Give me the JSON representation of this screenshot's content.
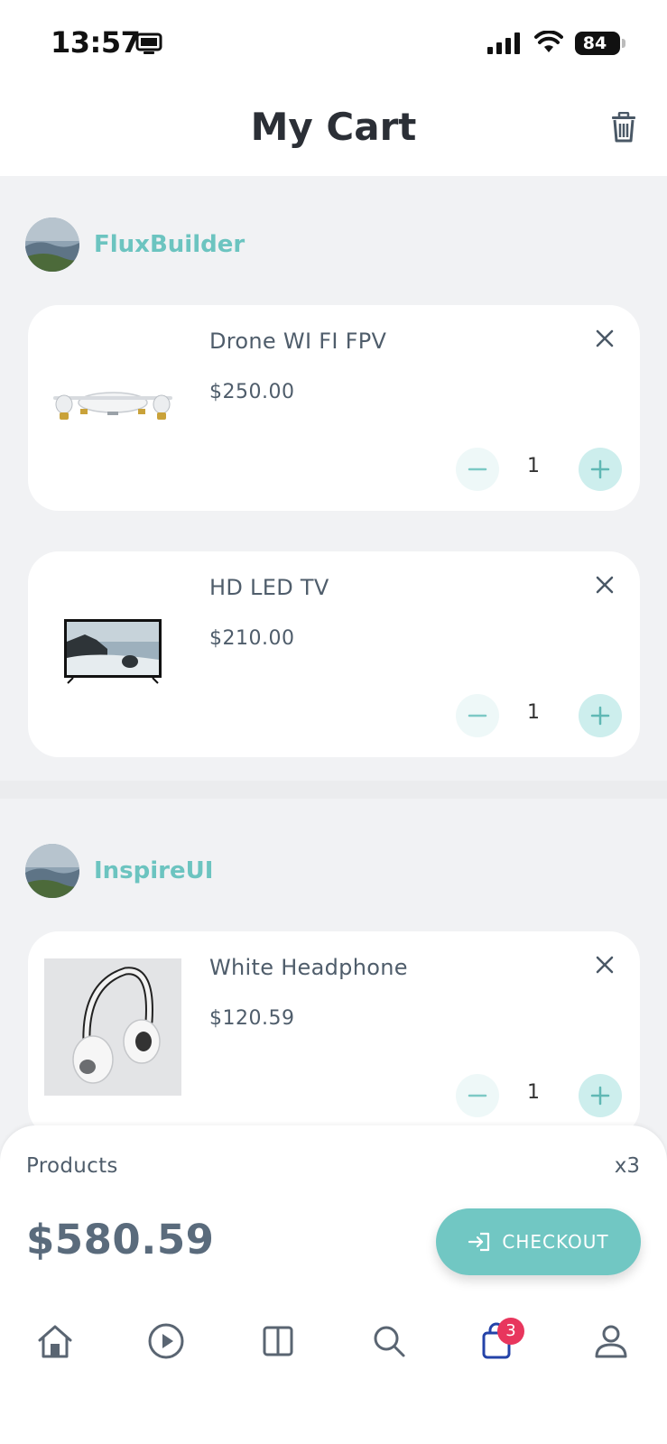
{
  "status_bar": {
    "time": "13:57",
    "battery": "84"
  },
  "header": {
    "title": "My Cart"
  },
  "stores": [
    {
      "name": "FluxBuilder",
      "items": [
        {
          "name": "Drone WI FI FPV",
          "price": "$250.00",
          "quantity": "1"
        },
        {
          "name": "HD LED TV",
          "price": "$210.00",
          "quantity": "1"
        }
      ]
    },
    {
      "name": "InspireUI",
      "items": [
        {
          "name": "White Headphone",
          "price": "$120.59",
          "quantity": "1"
        }
      ]
    }
  ],
  "summary": {
    "products_label": "Products",
    "products_count": "x3",
    "total": "$580.59",
    "checkout_label": "CHECKOUT"
  },
  "bottom_nav": {
    "cart_badge": "3",
    "items": [
      "home-icon",
      "play-icon",
      "panels-icon",
      "search-icon",
      "shopping-bag-icon",
      "user-icon"
    ]
  },
  "colors": {
    "accent": "#71c7c3",
    "badge": "#e8365d",
    "active_nav": "#2443a8"
  }
}
